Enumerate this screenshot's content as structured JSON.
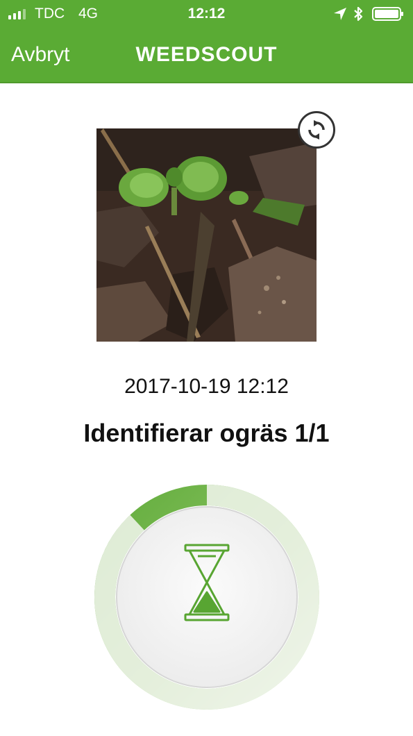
{
  "status_bar": {
    "carrier": "TDC",
    "network": "4G",
    "time": "12:12",
    "icons": [
      "signal-icon",
      "location-icon",
      "bluetooth-icon",
      "battery-icon"
    ]
  },
  "nav": {
    "back_label": "Avbryt",
    "title": "WEEDSCOUT"
  },
  "photo": {
    "icon": "rotate-icon"
  },
  "timestamp": "2017-10-19 12:12",
  "status": "Identifierar ogräs 1/1",
  "progress": {
    "fraction": 0.12,
    "icon": "hourglass-icon"
  },
  "colors": {
    "brand": "#5aab34",
    "accent": "#4f9a2c"
  }
}
